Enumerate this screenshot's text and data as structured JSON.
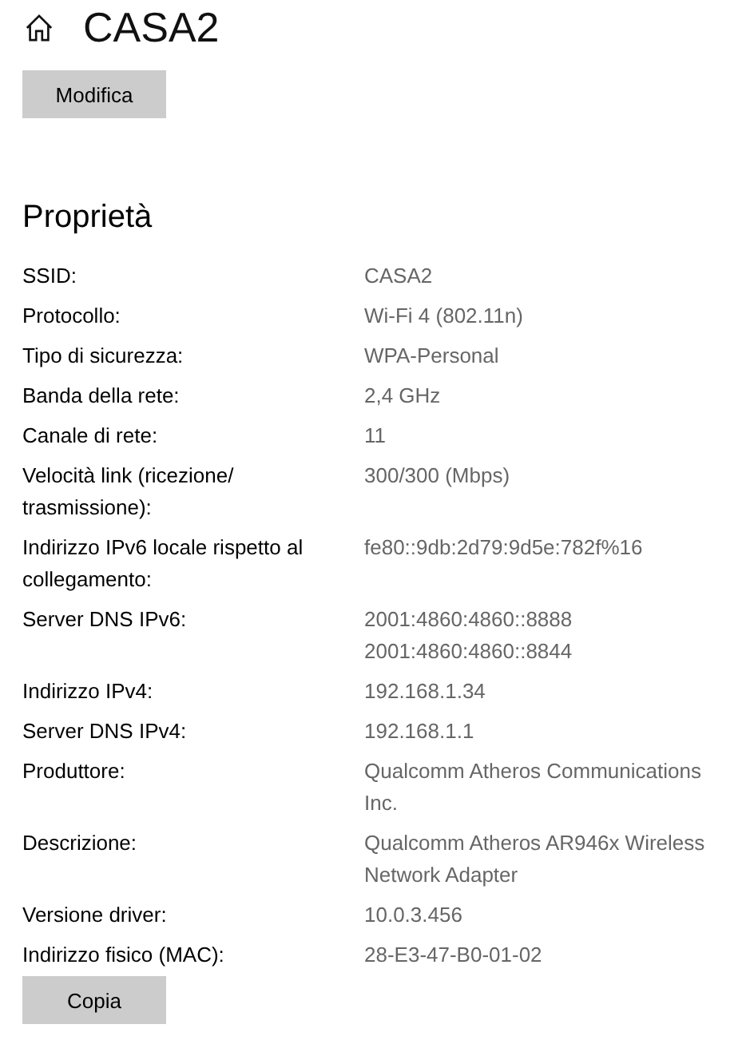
{
  "header": {
    "title": "CASA2"
  },
  "edit_button": "Modifica",
  "section_title": "Proprietà",
  "properties": [
    {
      "label": [
        "SSID:"
      ],
      "value": [
        "CASA2"
      ]
    },
    {
      "label": [
        "Protocollo:"
      ],
      "value": [
        "Wi-Fi 4 (802.11n)"
      ]
    },
    {
      "label": [
        "Tipo di sicurezza:"
      ],
      "value": [
        "WPA-Personal"
      ]
    },
    {
      "label": [
        "Banda della rete:"
      ],
      "value": [
        "2,4 GHz"
      ]
    },
    {
      "label": [
        "Canale di rete:"
      ],
      "value": [
        "11"
      ]
    },
    {
      "label": [
        "Velocità link (ricezione/",
        "trasmissione):"
      ],
      "value": [
        "300/300 (Mbps)"
      ]
    },
    {
      "label": [
        "Indirizzo IPv6 locale rispetto al",
        "collegamento:"
      ],
      "value": [
        "fe80::9db:2d79:9d5e:782f%16"
      ]
    },
    {
      "label": [
        "Server DNS IPv6:"
      ],
      "value": [
        "2001:4860:4860::8888",
        "2001:4860:4860::8844"
      ]
    },
    {
      "label": [
        "Indirizzo IPv4:"
      ],
      "value": [
        "192.168.1.34"
      ]
    },
    {
      "label": [
        "Server DNS IPv4:"
      ],
      "value": [
        "192.168.1.1"
      ]
    },
    {
      "label": [
        "Produttore:"
      ],
      "value": [
        "Qualcomm Atheros Communications",
        "Inc."
      ]
    },
    {
      "label": [
        "Descrizione:"
      ],
      "value": [
        "Qualcomm Atheros AR946x Wireless",
        "Network Adapter"
      ]
    },
    {
      "label": [
        "Versione driver:"
      ],
      "value": [
        "10.0.3.456"
      ]
    },
    {
      "label": [
        "Indirizzo fisico (MAC):"
      ],
      "value": [
        "28-E3-47-B0-01-02"
      ]
    }
  ],
  "copy_button": "Copia"
}
